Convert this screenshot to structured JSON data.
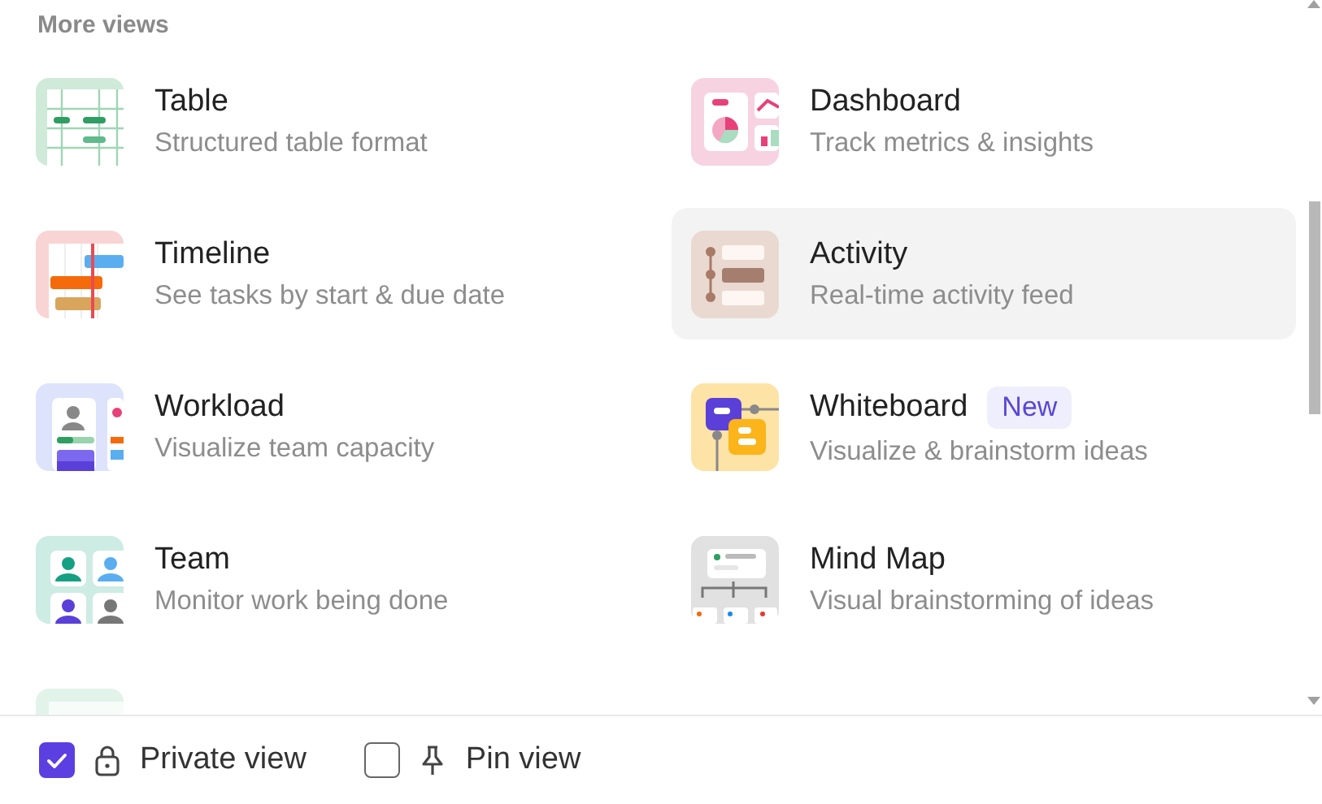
{
  "section_title": "More views",
  "views": [
    {
      "kind": "table",
      "title": "Table",
      "description": "Structured table format",
      "highlighted": false
    },
    {
      "kind": "dashboard",
      "title": "Dashboard",
      "description": "Track metrics & insights",
      "highlighted": false
    },
    {
      "kind": "timeline",
      "title": "Timeline",
      "description": "See tasks by start & due date",
      "highlighted": false
    },
    {
      "kind": "activity",
      "title": "Activity",
      "description": "Real-time activity feed",
      "highlighted": true
    },
    {
      "kind": "workload",
      "title": "Workload",
      "description": "Visualize team capacity",
      "highlighted": false
    },
    {
      "kind": "whiteboard",
      "title": "Whiteboard",
      "badge": "New",
      "description": "Visualize & brainstorm ideas",
      "highlighted": false
    },
    {
      "kind": "team",
      "title": "Team",
      "description": "Monitor work being done",
      "highlighted": false
    },
    {
      "kind": "mindmap",
      "title": "Mind Map",
      "description": "Visual brainstorming of ideas",
      "highlighted": false
    },
    {
      "kind": "partial"
    }
  ],
  "footer": [
    {
      "kind": "lock",
      "label": "Private view",
      "checked": true
    },
    {
      "kind": "pin",
      "label": "Pin view",
      "checked": false
    }
  ]
}
